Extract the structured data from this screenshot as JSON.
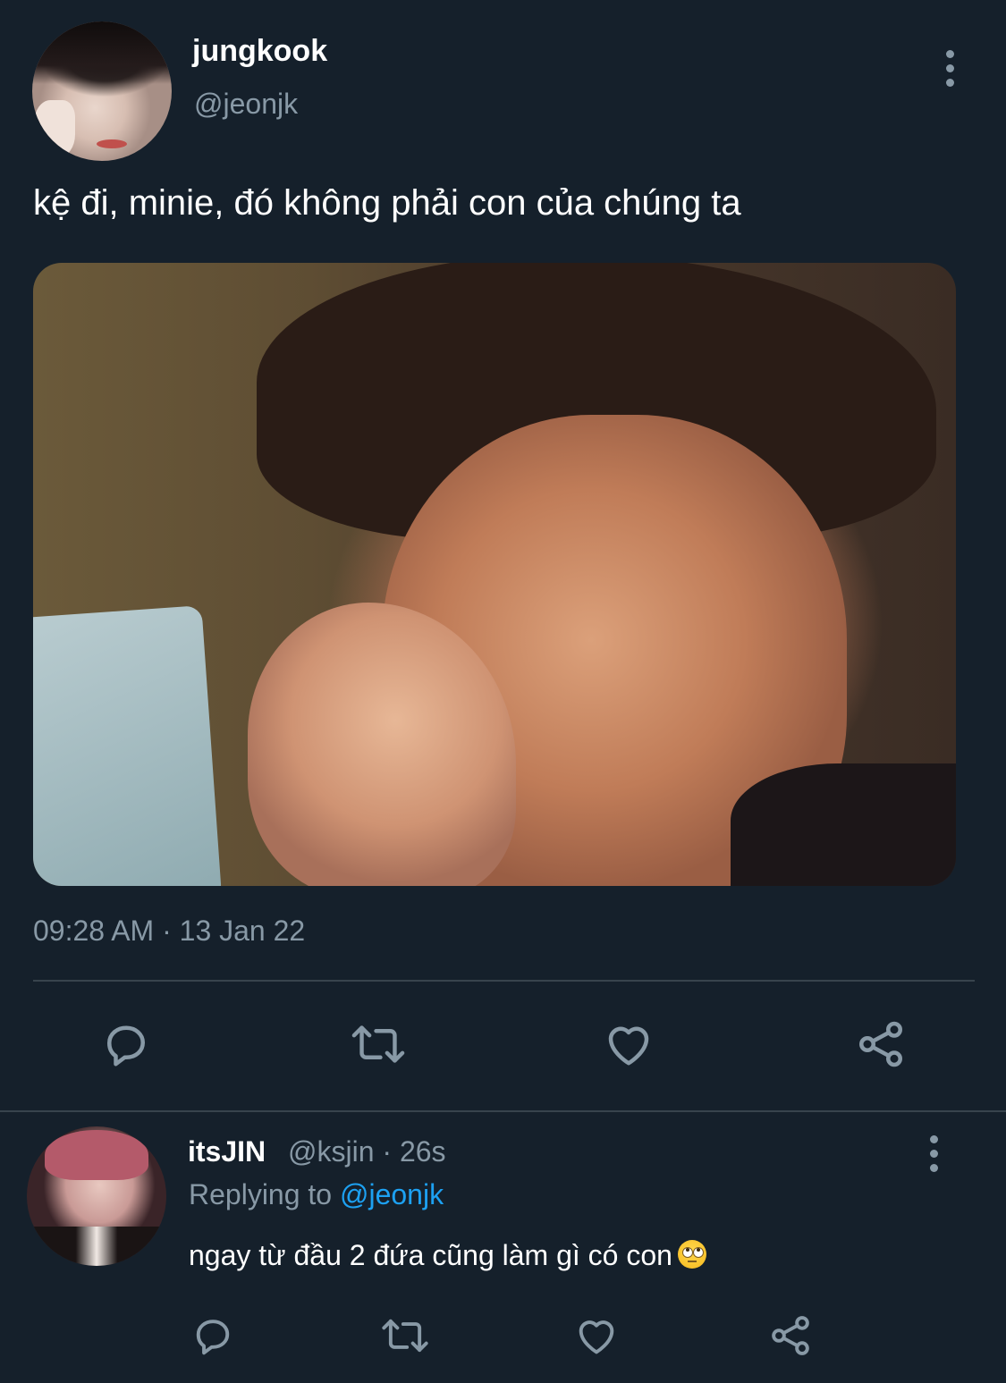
{
  "tweet": {
    "display_name": "jungkook",
    "handle": "@jeonjk",
    "text": "kệ đi, minie, đó không phải con của chúng ta",
    "timestamp": "09:28 AM · 13 Jan 22",
    "actions": [
      "reply-icon",
      "retweet-icon",
      "like-icon",
      "share-icon"
    ]
  },
  "reply": {
    "display_name": "itsJIN",
    "handle": "@ksjin",
    "separator": " · ",
    "time": "26s",
    "replying_prefix": "Replying to ",
    "replying_to": "@jeonjk",
    "text": "ngay từ đầu 2 đứa cũng làm gì có con",
    "emoji": "face-with-rolling-eyes",
    "actions": [
      "reply-icon",
      "retweet-icon",
      "like-icon",
      "share-icon"
    ]
  },
  "colors": {
    "background": "#15202b",
    "text": "#ffffff",
    "secondary": "#8899a6",
    "link": "#1da1f2",
    "divider": "#38444d"
  }
}
